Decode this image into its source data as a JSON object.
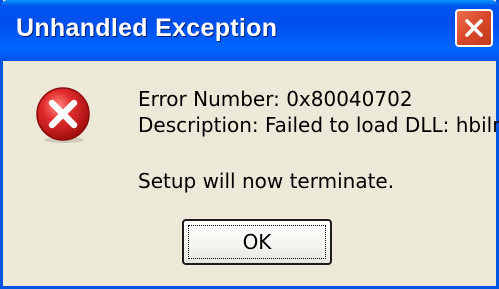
{
  "dialog": {
    "title": "Unhandled Exception",
    "close_icon": "close-icon",
    "error_icon": "error-icon",
    "error_number_line": "Error Number: 0x80040702",
    "description_line": "Description: Failed to load DLL: hbilm",
    "terminate_line": "Setup will now terminate.",
    "ok_label": "OK"
  },
  "colors": {
    "titlebar": "#0055e5",
    "window_body": "#ece9d8",
    "close_button": "#d9482a",
    "error_icon_red": "#d81e1e"
  }
}
